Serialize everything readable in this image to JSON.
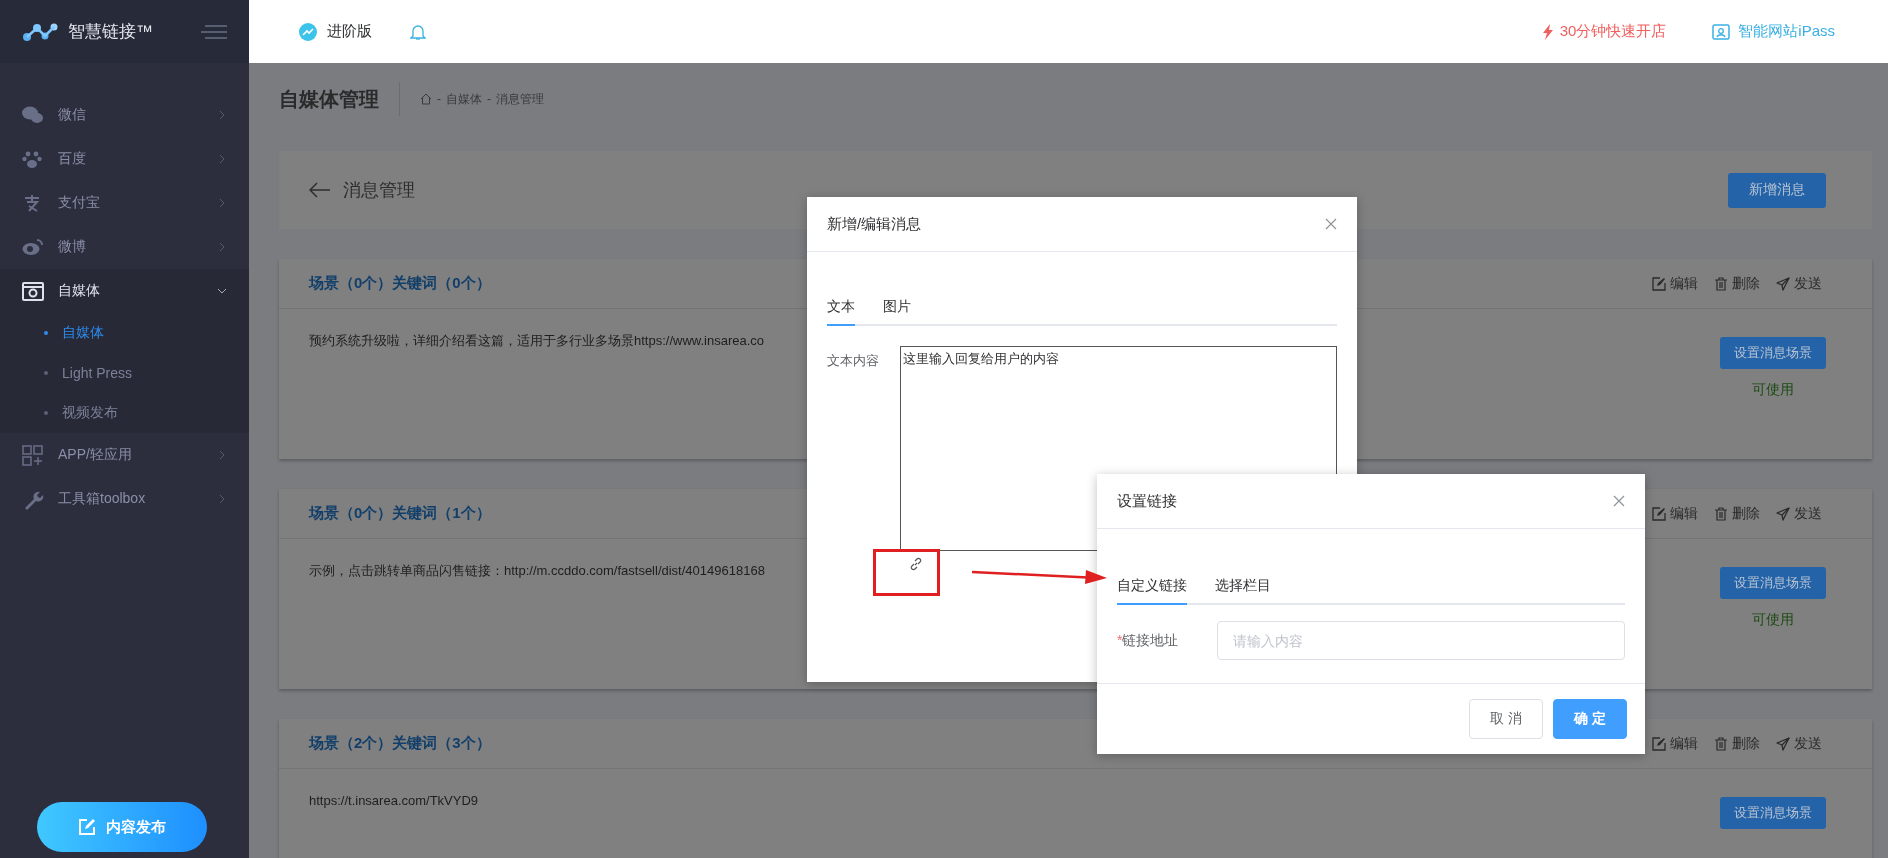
{
  "sidebar": {
    "logo": "智慧链接™",
    "items": [
      {
        "label": "微信",
        "selected": false,
        "expanded": false
      },
      {
        "label": "百度",
        "selected": false,
        "expanded": false
      },
      {
        "label": "支付宝",
        "selected": false,
        "expanded": false
      },
      {
        "label": "微博",
        "selected": false,
        "expanded": false
      },
      {
        "label": "自媒体",
        "selected": false,
        "expanded": true,
        "children": [
          {
            "label": "自媒体",
            "selected": true
          },
          {
            "label": "Light Press",
            "selected": false
          },
          {
            "label": "视频发布",
            "selected": false
          }
        ]
      },
      {
        "label": "APP/轻应用",
        "selected": false,
        "expanded": false
      },
      {
        "label": "工具箱toolbox",
        "selected": false,
        "expanded": false
      }
    ],
    "publish_button": "内容发布"
  },
  "header": {
    "plan": "进阶版",
    "promo": "30分钟快速开店",
    "site_link": "智能网站iPass"
  },
  "page": {
    "title": "自媒体管理",
    "breadcrumb": [
      {
        "separator": "-",
        "label": "自媒体"
      },
      {
        "separator": "-",
        "label": "消息管理"
      }
    ]
  },
  "panel": {
    "back_title": "消息管理",
    "add_button": "新增消息"
  },
  "messages": [
    {
      "title": "场景（0个）关键词（0个）",
      "actions": [
        "编辑",
        "删除",
        "发送"
      ],
      "text": "预约系统升级啦，详细介绍看这篇，适用于多行业多场景https://www.insarea.co",
      "button": "设置消息场景",
      "status": "可使用"
    },
    {
      "title": "场景（0个）关键词（1个）",
      "actions": [
        "编辑",
        "删除",
        "发送"
      ],
      "text": "示例，点击跳转单商品闪售链接：http://m.ccddo.com/fastsell/dist/40149618168",
      "button": "设置消息场景",
      "status": "可使用"
    },
    {
      "title": "场景（2个）关键词（3个）",
      "actions": [
        "编辑",
        "删除",
        "发送"
      ],
      "text": "https://t.insarea.com/TkVYD9",
      "button": "设置消息场景"
    }
  ],
  "edit_dialog": {
    "title": "新增/编辑消息",
    "tabs": [
      {
        "label": "文本",
        "selected": true
      },
      {
        "label": "图片",
        "selected": false
      }
    ],
    "field_label": "文本内容",
    "field_value": "这里输入回复给用户的内容"
  },
  "link_dialog": {
    "title": "设置链接",
    "tabs": [
      {
        "label": "自定义链接",
        "selected": true
      },
      {
        "label": "选择栏目",
        "selected": false
      }
    ],
    "field": {
      "required_mark": "*",
      "label": "链接地址",
      "placeholder": "请输入内容"
    },
    "buttons": [
      {
        "label": "取 消",
        "kind": "default"
      },
      {
        "label": "确 定",
        "kind": "primary"
      }
    ]
  }
}
